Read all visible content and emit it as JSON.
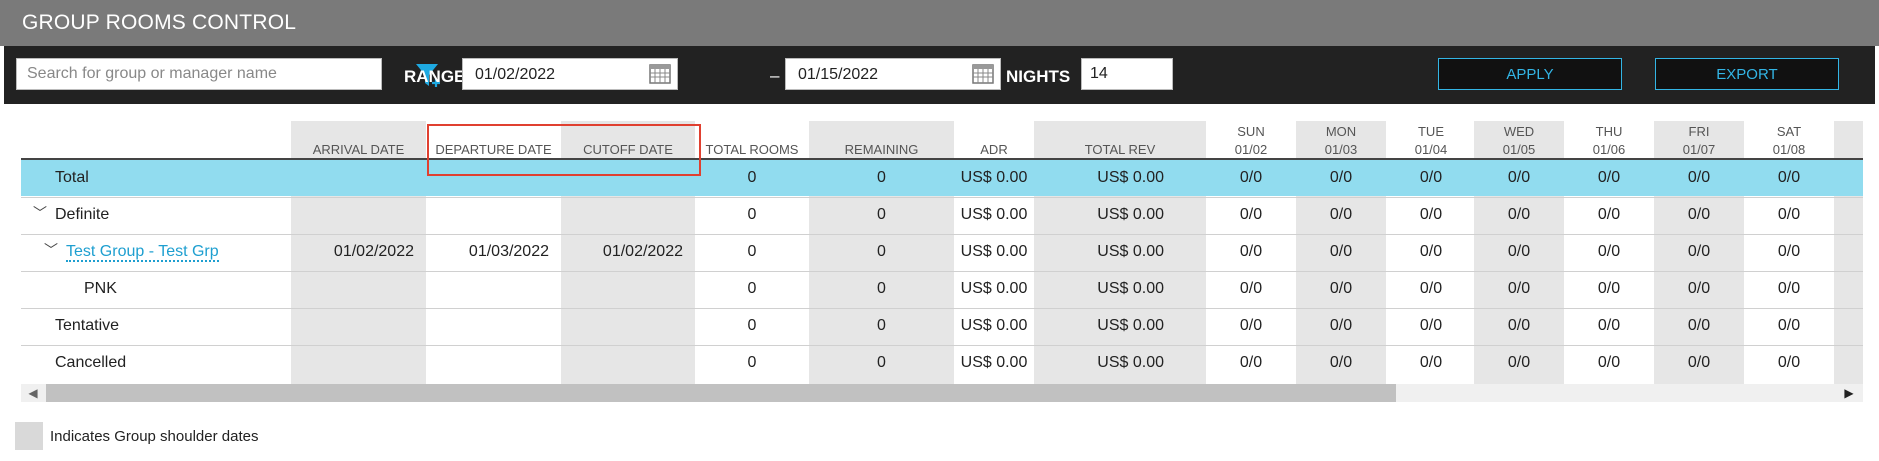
{
  "title": "GROUP ROOMS CONTROL",
  "toolbar": {
    "search_placeholder": "Search for group or manager name",
    "range_label": "RANGE",
    "range_start": "01/02/2022",
    "range_separator": "–",
    "range_end": "01/15/2022",
    "nights_label": "NIGHTS",
    "nights_value": "14",
    "apply_label": "APPLY",
    "export_label": "EXPORT"
  },
  "columns": {
    "arrival": "ARRIVAL DATE",
    "departure": "DEPARTURE DATE",
    "cutoff": "CUTOFF DATE",
    "total_rooms": "TOTAL ROOMS",
    "remaining": "REMAINING",
    "adr": "ADR",
    "total_rev": "TOTAL REV",
    "days": [
      {
        "dow": "SUN",
        "date": "01/02"
      },
      {
        "dow": "MON",
        "date": "01/03"
      },
      {
        "dow": "TUE",
        "date": "01/04"
      },
      {
        "dow": "WED",
        "date": "01/05"
      },
      {
        "dow": "THU",
        "date": "01/06"
      },
      {
        "dow": "FRI",
        "date": "01/07"
      },
      {
        "dow": "SAT",
        "date": "01/08"
      }
    ]
  },
  "rows": [
    {
      "label": "Total",
      "arrival": "",
      "departure": "",
      "cutoff": "",
      "total_rooms": "0",
      "remaining": "0",
      "adr": "US$ 0.00",
      "total_rev": "US$ 0.00",
      "days": [
        "0/0",
        "0/0",
        "0/0",
        "0/0",
        "0/0",
        "0/0",
        "0/0"
      ]
    },
    {
      "label": "Definite",
      "arrival": "",
      "departure": "",
      "cutoff": "",
      "total_rooms": "0",
      "remaining": "0",
      "adr": "US$ 0.00",
      "total_rev": "US$ 0.00",
      "days": [
        "0/0",
        "0/0",
        "0/0",
        "0/0",
        "0/0",
        "0/0",
        "0/0"
      ]
    },
    {
      "label": "Test Group - Test Grp",
      "arrival": "01/02/2022",
      "departure": "01/03/2022",
      "cutoff": "01/02/2022",
      "total_rooms": "0",
      "remaining": "0",
      "adr": "US$ 0.00",
      "total_rev": "US$ 0.00",
      "days": [
        "0/0",
        "0/0",
        "0/0",
        "0/0",
        "0/0",
        "0/0",
        "0/0"
      ]
    },
    {
      "label": "PNK",
      "arrival": "",
      "departure": "",
      "cutoff": "",
      "total_rooms": "0",
      "remaining": "0",
      "adr": "US$ 0.00",
      "total_rev": "US$ 0.00",
      "days": [
        "0/0",
        "0/0",
        "0/0",
        "0/0",
        "0/0",
        "0/0",
        "0/0"
      ]
    },
    {
      "label": "Tentative",
      "arrival": "",
      "departure": "",
      "cutoff": "",
      "total_rooms": "0",
      "remaining": "0",
      "adr": "US$ 0.00",
      "total_rev": "US$ 0.00",
      "days": [
        "0/0",
        "0/0",
        "0/0",
        "0/0",
        "0/0",
        "0/0",
        "0/0"
      ]
    },
    {
      "label": "Cancelled",
      "arrival": "",
      "departure": "",
      "cutoff": "",
      "total_rooms": "0",
      "remaining": "0",
      "adr": "US$ 0.00",
      "total_rev": "US$ 0.00",
      "days": [
        "0/0",
        "0/0",
        "0/0",
        "0/0",
        "0/0",
        "0/0",
        "0/0"
      ]
    }
  ],
  "legend": "Indicates Group shoulder dates",
  "colors": {
    "total_row": "#91dcef",
    "link": "#1e9fd0",
    "button_border": "#33b5e5",
    "highlight": "#e04030",
    "shoulder": "#e6e6e6"
  }
}
